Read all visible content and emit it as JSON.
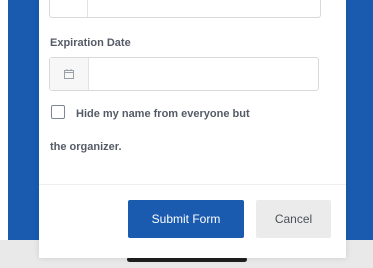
{
  "form": {
    "expiration_label": "Expiration Date",
    "expiration_value": "",
    "expiration_placeholder": "",
    "hide_name_line1": "Hide my name from everyone but",
    "hide_name_line2": "the organizer.",
    "hide_name_checked": false
  },
  "buttons": {
    "submit_label": "Submit Form",
    "cancel_label": "Cancel"
  },
  "icons": {
    "date": "calendar-icon"
  },
  "colors": {
    "primary": "#1a5bb0",
    "label_text": "#555b66",
    "cancel_bg": "#ebebeb"
  }
}
